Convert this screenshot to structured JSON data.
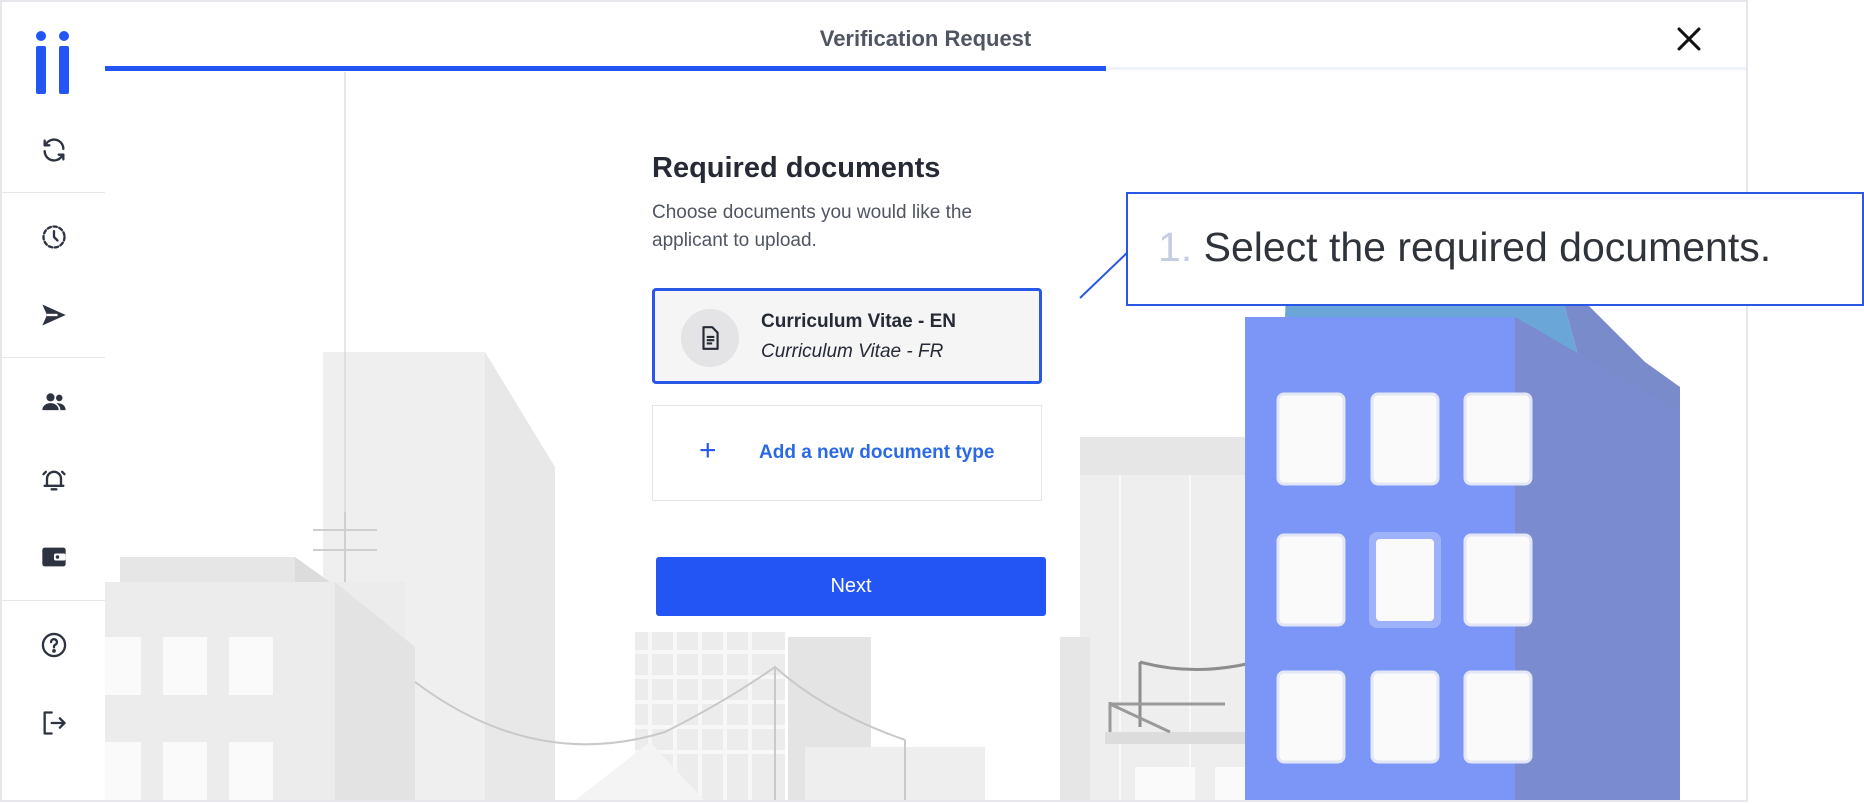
{
  "header": {
    "title": "Verification Request",
    "progress_fraction": 0.61
  },
  "sidebar": {
    "items": [
      {
        "name": "refresh-icon"
      },
      {
        "name": "history-icon"
      },
      {
        "name": "send-icon"
      },
      {
        "name": "users-icon"
      },
      {
        "name": "alarm-icon"
      },
      {
        "name": "wallet-icon"
      },
      {
        "name": "help-icon"
      },
      {
        "name": "logout-icon"
      }
    ]
  },
  "main": {
    "heading": "Required documents",
    "description": "Choose documents you would like the applicant to upload.",
    "document": {
      "title": "Curriculum Vitae - EN",
      "subtitle": "Curriculum Vitae - FR"
    },
    "add_label": "Add a new document type",
    "add_symbol": "+",
    "next_label": "Next"
  },
  "callout": {
    "number": "1.",
    "text": "Select the required documents."
  },
  "colors": {
    "accent": "#2355f5",
    "building": "#7b96f6",
    "building_side": "#7a8bd0"
  }
}
